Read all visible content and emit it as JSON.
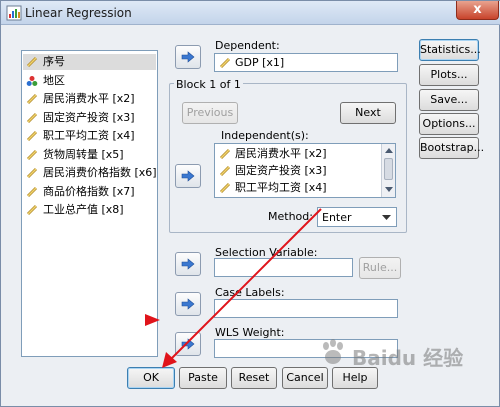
{
  "window": {
    "title": "Linear Regression",
    "close_glyph": "x"
  },
  "variables": [
    {
      "label": "序号",
      "type": "scale",
      "selected": true
    },
    {
      "label": "地区",
      "type": "nominal",
      "selected": false
    },
    {
      "label": "居民消费水平 [x2]",
      "type": "scale",
      "selected": false
    },
    {
      "label": "固定资产投资 [x3]",
      "type": "scale",
      "selected": false
    },
    {
      "label": "职工平均工资 [x4]",
      "type": "scale",
      "selected": false
    },
    {
      "label": "货物周转量 [x5]",
      "type": "scale",
      "selected": false
    },
    {
      "label": "居民消费价格指数 [x6]",
      "type": "scale",
      "selected": false
    },
    {
      "label": "商品价格指数 [x7]",
      "type": "scale",
      "selected": false
    },
    {
      "label": "工业总产值 [x8]",
      "type": "scale",
      "selected": false
    }
  ],
  "dependent": {
    "label": "Dependent:",
    "value": "GDP [x1]"
  },
  "block": {
    "label": "Block 1 of 1",
    "previous": "Previous",
    "next": "Next"
  },
  "independent": {
    "label": "Independent(s):",
    "items": [
      "居民消费水平 [x2]",
      "固定资产投资 [x3]",
      "职工平均工资 [x4]"
    ]
  },
  "method": {
    "label": "Method:",
    "value": "Enter"
  },
  "selection_variable": {
    "label": "Selection Variable:",
    "value": "",
    "rule": "Rule..."
  },
  "case_labels": {
    "label": "Case Labels:",
    "value": ""
  },
  "wls_weight": {
    "label": "WLS Weight:",
    "value": ""
  },
  "side_buttons": [
    "Statistics...",
    "Plots...",
    "Save...",
    "Options...",
    "Bootstrap..."
  ],
  "bottom_buttons": {
    "ok": "OK",
    "paste": "Paste",
    "reset": "Reset",
    "cancel": "Cancel",
    "help": "Help"
  },
  "colors": {
    "annotation_red": "#e0141b",
    "arrow_blue": "#3b78d0"
  },
  "watermark": "Baidu 经验"
}
